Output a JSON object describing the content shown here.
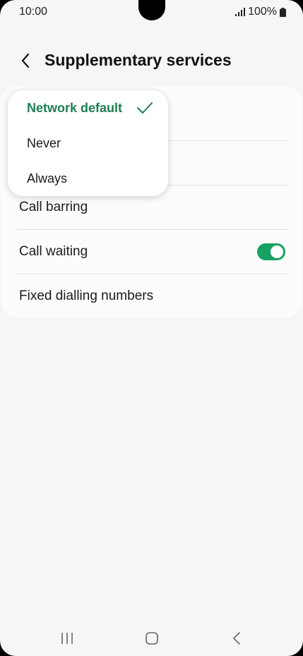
{
  "status_bar": {
    "time": "10:00",
    "battery_text": "100%",
    "icons": [
      "signal-icon",
      "battery-icon"
    ]
  },
  "header": {
    "title": "Supplementary services",
    "back_icon": "chevron-left-icon"
  },
  "settings": {
    "items": [
      {
        "label": "Call barring"
      },
      {
        "label": "Call waiting",
        "toggle_on": true
      },
      {
        "label": "Fixed dialling numbers"
      }
    ]
  },
  "popup": {
    "options": [
      {
        "label": "Network default",
        "selected": true
      },
      {
        "label": "Never",
        "selected": false
      },
      {
        "label": "Always",
        "selected": false
      }
    ],
    "check_icon": "check-icon"
  },
  "nav_bar": {
    "icons": [
      "recent-apps-icon",
      "home-icon",
      "back-icon"
    ]
  },
  "colors": {
    "accent": "#1aa162",
    "selected_text": "#1d7f52",
    "background": "#f6f6f8"
  }
}
